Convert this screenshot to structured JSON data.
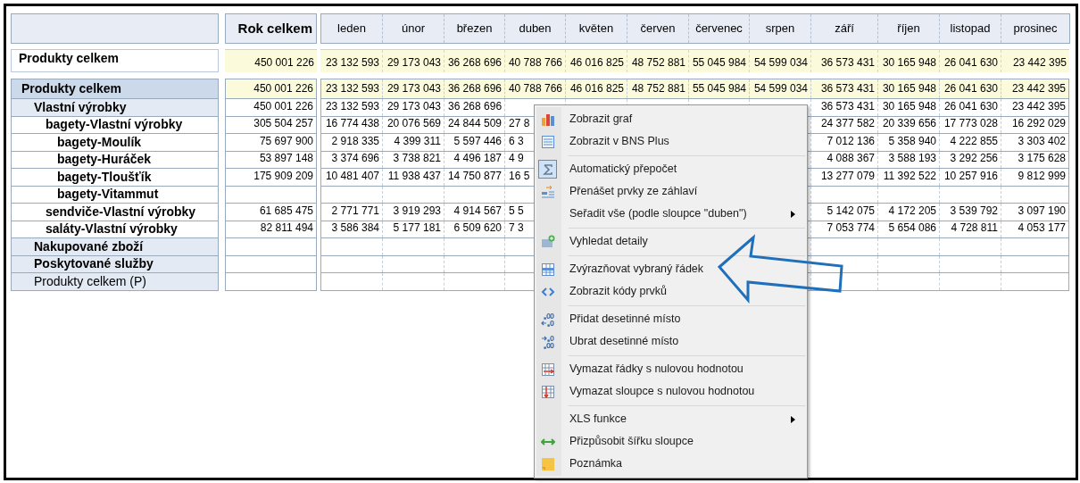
{
  "table": {
    "total_header": "Rok celkem",
    "months": [
      "leden",
      "únor",
      "březen",
      "duben",
      "květen",
      "červen",
      "červenec",
      "srpen",
      "září",
      "říjen",
      "listopad",
      "prosinec"
    ],
    "summary_row": {
      "label": "Produkty celkem",
      "total": "450 001 226",
      "cells_left": [
        "23 132 593",
        "29 173 043",
        "36 268 696",
        "40 788 766",
        "46 016 825",
        "48 752 881",
        "55 045 984",
        "54 599 034"
      ],
      "cells_right": [
        "36 573 431",
        "30 165 948",
        "26 041 630",
        "23 442 395"
      ]
    },
    "rows": [
      {
        "label": "Produkty celkem",
        "bold": true,
        "total": "450 001 226",
        "cells_left": [
          "23 132 593",
          "29 173 043",
          "36 268 696",
          "40 788 766",
          "46 016 825",
          "48 752 881",
          "55 045 984",
          "54 599 034"
        ],
        "cells_right": [
          "36 573 431",
          "30 165 948",
          "26 041 630",
          "23 442 395"
        ],
        "children": [
          {
            "label": "Vlastní výrobky",
            "bold": true,
            "total": "450 001 226",
            "cells_left": [
              "23 132 593",
              "29 173 043",
              "36 268 696"
            ],
            "cells_right": [
              "36 573 431",
              "30 165 948",
              "26 041 630",
              "23 442 395"
            ],
            "children": [
              {
                "label": "bagety-Vlastní výrobky",
                "bold": true,
                "total": "305 504 257",
                "cells_left": [
                  "16 774 438",
                  "20 076 569",
                  "24 844 509",
                  "27 8"
                ],
                "cells_right": [
                  "24 377 582",
                  "20 339 656",
                  "17 773 028",
                  "16 292 029"
                ],
                "children": [
                  {
                    "label": "bagety-Moulík",
                    "bold": true,
                    "total": "75 697 900",
                    "cells_left": [
                      "2 918 335",
                      "4 399 311",
                      "5 597 446",
                      "6 3"
                    ],
                    "cells_right": [
                      "7 012 136",
                      "5 358 940",
                      "4 222 855",
                      "3 303 402"
                    ]
                  },
                  {
                    "label": "bagety-Huráček",
                    "bold": true,
                    "total": "53 897 148",
                    "cells_left": [
                      "3 374 696",
                      "3 738 821",
                      "4 496 187",
                      "4 9"
                    ],
                    "cells_right": [
                      "4 088 367",
                      "3 588 193",
                      "3 292 256",
                      "3 175 628"
                    ]
                  },
                  {
                    "label": "bagety-Tloušťík",
                    "bold": true,
                    "total": "175 909 209",
                    "cells_left": [
                      "10 481 407",
                      "11 938 437",
                      "14 750 877",
                      "16 5"
                    ],
                    "cells_right": [
                      "13 277 079",
                      "11 392 522",
                      "10 257 916",
                      "9 812 999"
                    ]
                  },
                  {
                    "label": "bagety-Vitammut",
                    "bold": true
                  }
                ]
              },
              {
                "label": "sendviče-Vlastní výrobky",
                "bold": true,
                "total": "61 685 475",
                "cells_left": [
                  "2 771 771",
                  "3 919 293",
                  "4 914 567",
                  "5 5"
                ],
                "cells_right": [
                  "5 142 075",
                  "4 172 205",
                  "3 539 792",
                  "3 097 190"
                ]
              },
              {
                "label": "saláty-Vlastní výrobky",
                "bold": true,
                "total": "82 811 494",
                "cells_left": [
                  "3 586 384",
                  "5 177 181",
                  "6 509 620",
                  "7 3"
                ],
                "cells_right": [
                  "7 053 774",
                  "5 654 086",
                  "4 728 811",
                  "4 053 177"
                ]
              }
            ]
          },
          {
            "label": "Nakupované zboží",
            "bold": true
          },
          {
            "label": "Poskytované služby",
            "bold": true
          },
          {
            "label": "Produkty celkem (P)",
            "bold": false
          }
        ]
      }
    ]
  },
  "context_menu": {
    "items": [
      {
        "kind": "item",
        "label": "Zobrazit graf",
        "checked": false,
        "submenu": false
      },
      {
        "kind": "item",
        "label": "Zobrazit v BNS Plus",
        "checked": false,
        "submenu": false
      },
      {
        "kind": "separator"
      },
      {
        "kind": "item",
        "label": "Automatický přepočet",
        "checked": true,
        "submenu": false
      },
      {
        "kind": "item",
        "label": "Přenášet prvky ze záhlaví",
        "checked": false,
        "submenu": false
      },
      {
        "kind": "item",
        "label": "Seřadit vše (podle sloupce \"duben\")",
        "checked": false,
        "submenu": true
      },
      {
        "kind": "separator"
      },
      {
        "kind": "item",
        "label": "Vyhledat detaily",
        "checked": false,
        "submenu": false
      },
      {
        "kind": "separator"
      },
      {
        "kind": "item",
        "label": "Zvýrazňovat vybraný řádek",
        "checked": false,
        "submenu": false
      },
      {
        "kind": "item",
        "label": "Zobrazit kódy prvků",
        "checked": false,
        "submenu": false
      },
      {
        "kind": "separator"
      },
      {
        "kind": "item",
        "label": "Přidat desetinné místo",
        "checked": false,
        "submenu": false
      },
      {
        "kind": "item",
        "label": "Ubrat desetinné místo",
        "checked": false,
        "submenu": false
      },
      {
        "kind": "separator"
      },
      {
        "kind": "item",
        "label": "Vymazat řádky s nulovou hodnotou",
        "checked": false,
        "submenu": false
      },
      {
        "kind": "item",
        "label": "Vymazat sloupce s nulovou hodnotou",
        "checked": false,
        "submenu": false
      },
      {
        "kind": "separator"
      },
      {
        "kind": "item",
        "label": "XLS funkce",
        "checked": false,
        "submenu": true
      },
      {
        "kind": "item",
        "label": "Přizpůsobit šířku sloupce",
        "checked": false,
        "submenu": false
      },
      {
        "kind": "item",
        "label": "Poznámka",
        "checked": false,
        "submenu": false
      }
    ]
  }
}
